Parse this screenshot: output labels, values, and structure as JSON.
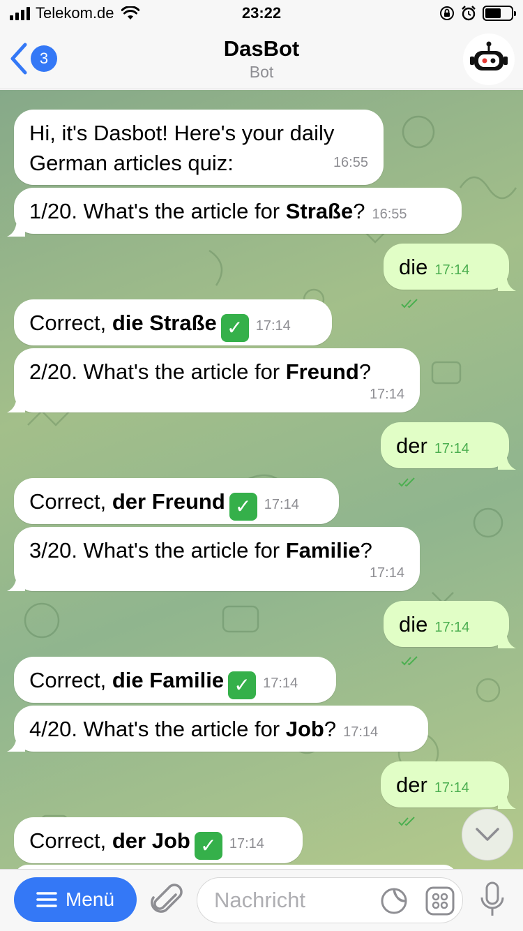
{
  "status_bar": {
    "carrier": "Telekom.de",
    "time": "23:22"
  },
  "header": {
    "back_count": "3",
    "title": "DasBot",
    "subtitle": "Bot"
  },
  "messages": [
    {
      "dir": "in",
      "text": "Hi, it's Dasbot! Here's your daily German articles quiz:",
      "time": "16:55"
    },
    {
      "dir": "in",
      "prefix": "1/20. What's the article for ",
      "bold": "Straße",
      "suffix": "?",
      "time": "16:55"
    },
    {
      "dir": "out",
      "text": "die",
      "time": "17:14"
    },
    {
      "dir": "in",
      "prefix": "Correct, ",
      "bold": "die Straße",
      "time": "17:14"
    },
    {
      "dir": "in",
      "prefix": "2/20. What's the article for ",
      "bold": "Freund",
      "suffix": "?",
      "time": "17:14"
    },
    {
      "dir": "out",
      "text": "der",
      "time": "17:14"
    },
    {
      "dir": "in",
      "prefix": "Correct, ",
      "bold": "der Freund",
      "time": "17:14"
    },
    {
      "dir": "in",
      "prefix": "3/20. What's the article for ",
      "bold": "Familie",
      "suffix": "?",
      "time": "17:14"
    },
    {
      "dir": "out",
      "text": "die",
      "time": "17:14"
    },
    {
      "dir": "in",
      "prefix": "Correct, ",
      "bold": "die Familie",
      "time": "17:14"
    },
    {
      "dir": "in",
      "prefix": "4/20. What's the article for ",
      "bold": "Job",
      "suffix": "?",
      "time": "17:14"
    },
    {
      "dir": "out",
      "text": "der",
      "time": "17:14"
    },
    {
      "dir": "in",
      "prefix": "Correct, ",
      "bold": "der Job",
      "time": "17:14"
    }
  ],
  "input_bar": {
    "menu_label": "Menü",
    "placeholder": "Nachricht"
  },
  "colors": {
    "accent": "#3478f6",
    "outgoing_bubble": "#e1fec6",
    "check_green": "#35b04a"
  },
  "icons": {
    "back": "chevron-left-icon",
    "avatar": "robot-icon",
    "attach": "paperclip-icon",
    "sticker": "sticker-icon",
    "commands": "command-grid-icon",
    "mic": "microphone-icon",
    "scroll": "chevron-down-icon"
  }
}
